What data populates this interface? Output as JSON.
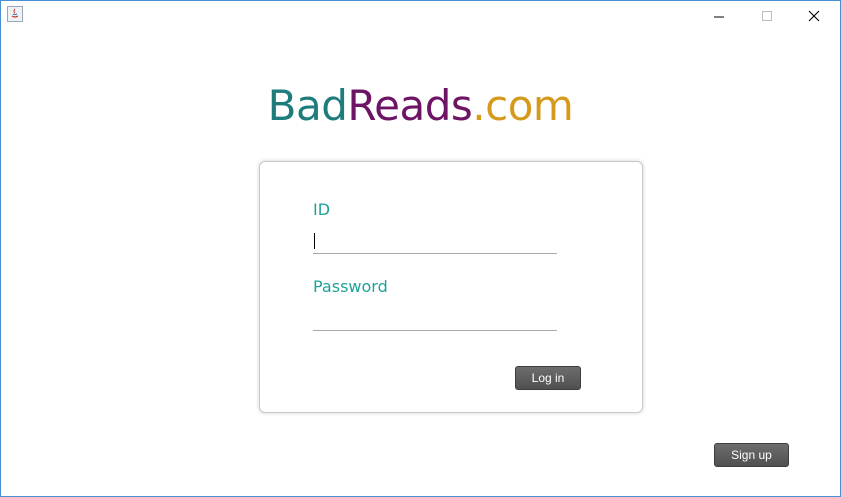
{
  "brand": {
    "part1": "Bad",
    "part2": "Reads",
    "part3": ".com"
  },
  "colors": {
    "teal": "#1f7c7c",
    "purple": "#6d1464",
    "gold": "#d59a1b",
    "label": "#1ea39a",
    "window_border": "#4a8fd0"
  },
  "window": {
    "controls": [
      "minimize-icon",
      "maximize-icon",
      "close-icon"
    ]
  },
  "login": {
    "id_label": "ID",
    "id_value": "",
    "password_label": "Password",
    "password_value": "",
    "login_button": "Log in"
  },
  "signup_button": "Sign up"
}
